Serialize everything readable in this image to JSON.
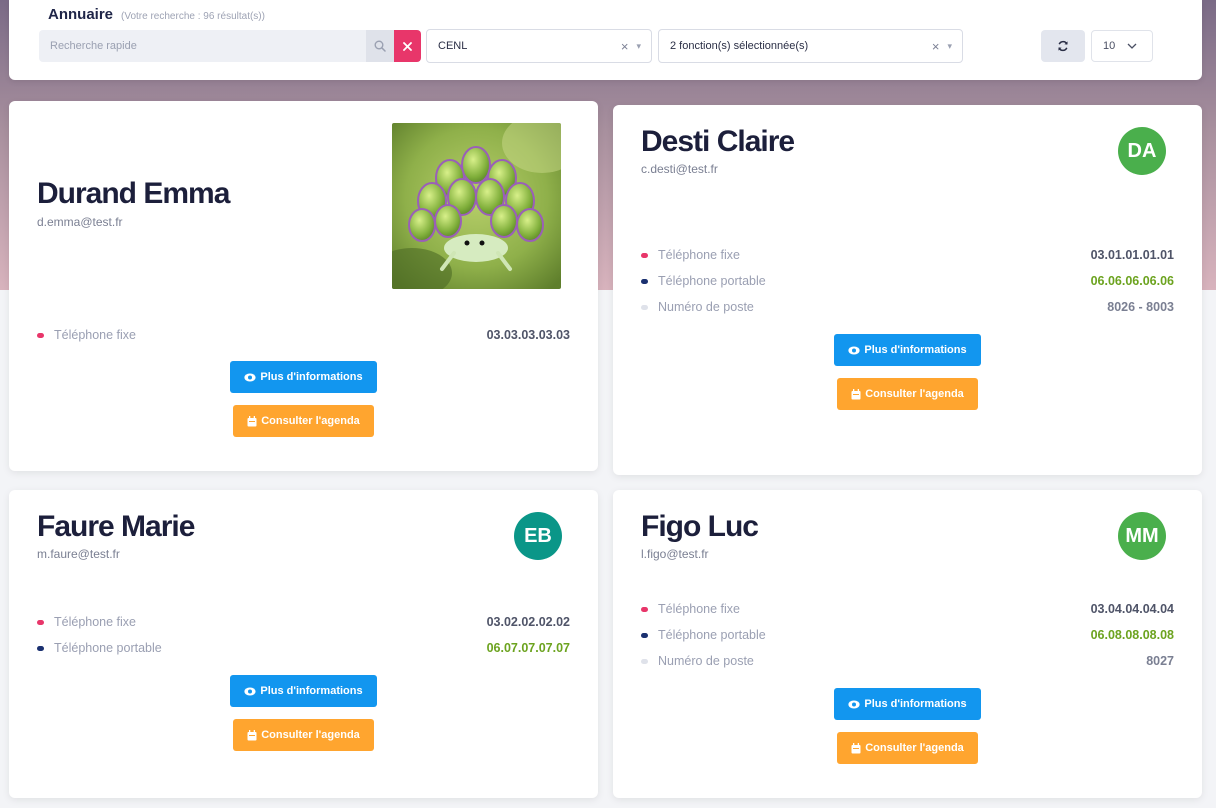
{
  "header": {
    "title": "Annuaire",
    "subtitle": "(Votre recherche : 96 résultat(s))"
  },
  "search": {
    "placeholder": "Recherche rapide",
    "value": "",
    "search_icon": "search-icon",
    "clear_icon": "close-icon"
  },
  "filters": {
    "organisation": {
      "value": "CENL"
    },
    "fonctions": {
      "value": "2 fonction(s) sélectionnée(s)"
    },
    "clear_glyph": "×",
    "caret_glyph": "▾"
  },
  "toolbar": {
    "refresh_icon": "refresh-icon",
    "per_page": "10",
    "per_page_caret": "⌵"
  },
  "colors": {
    "fixe_dot": "#e8366a",
    "portable_dot": "#1a3070",
    "poste_dot": "#dfe2ea",
    "btn_info": "#1296ef",
    "btn_agenda": "#ffa52f",
    "portable_number": "#6ca31f"
  },
  "cards": [
    {
      "name": "Durand Emma",
      "email": "d.emma@test.fr",
      "photo": "sea-slug-photo",
      "rows": [
        {
          "label": "Téléphone fixe",
          "value": "03.03.03.03.03"
        }
      ],
      "btn_info": "Plus d'informations",
      "btn_agenda": "Consulter l'agenda"
    },
    {
      "name": "Desti Claire",
      "email": "c.desti@test.fr",
      "avatar": "DA",
      "avatar_color": "#4aaf4c",
      "rows": [
        {
          "label": "Téléphone fixe",
          "value": "03.01.01.01.01"
        },
        {
          "label": "Téléphone portable",
          "value": "06.06.06.06.06"
        },
        {
          "label": "Numéro de poste",
          "value": "8026 - 8003"
        }
      ],
      "btn_info": "Plus d'informations",
      "btn_agenda": "Consulter l'agenda"
    },
    {
      "name": "Faure Marie",
      "email": "m.faure@test.fr",
      "avatar": "EB",
      "avatar_color": "#0a9688",
      "rows": [
        {
          "label": "Téléphone fixe",
          "value": "03.02.02.02.02"
        },
        {
          "label": "Téléphone portable",
          "value": "06.07.07.07.07"
        }
      ],
      "btn_info": "Plus d'informations",
      "btn_agenda": "Consulter l'agenda"
    },
    {
      "name": "Figo Luc",
      "email": "l.figo@test.fr",
      "avatar": "MM",
      "avatar_color": "#4aaf4c",
      "rows": [
        {
          "label": "Téléphone fixe",
          "value": "03.04.04.04.04"
        },
        {
          "label": "Téléphone portable",
          "value": "06.08.08.08.08"
        },
        {
          "label": "Numéro de poste",
          "value": "8027"
        }
      ],
      "btn_info": "Plus d'informations",
      "btn_agenda": "Consulter l'agenda"
    }
  ]
}
